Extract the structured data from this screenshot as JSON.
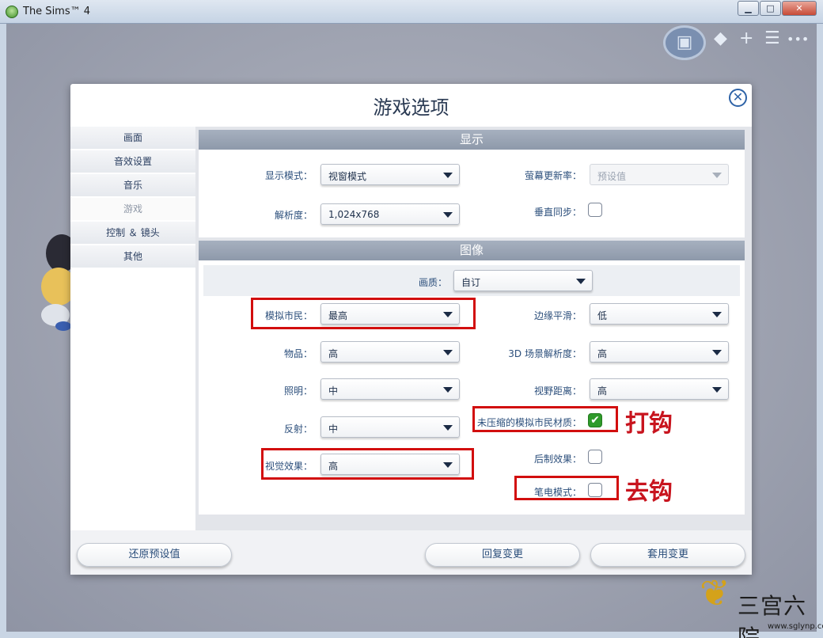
{
  "window": {
    "title": "The Sims™ 4",
    "controls": {
      "minimize": "▁",
      "maximize": "□",
      "close": "✕"
    }
  },
  "top_tools": {
    "photo": "▣",
    "tag": "◆",
    "plus": "+",
    "list": "☰",
    "more": "•••"
  },
  "dialog": {
    "title": "游戏选项",
    "close_icon": "✕",
    "nav": [
      "画面",
      "音效设置",
      "音乐",
      "游戏",
      "控制 ＆ 镜头",
      "其他"
    ],
    "display": {
      "header": "显示",
      "display_mode": {
        "label": "显示模式：",
        "value": "视窗模式"
      },
      "refresh_rate": {
        "label": "萤幕更新率：",
        "value": "预设值"
      },
      "resolution": {
        "label": "解析度：",
        "value": "1,024x768"
      },
      "vsync": {
        "label": "垂直同步：",
        "checked": false
      }
    },
    "graphics": {
      "header": "图像",
      "quality": {
        "label": "画质：",
        "value": "自订"
      },
      "sims": {
        "label": "模拟市民：",
        "value": "最高"
      },
      "edge_smoothing": {
        "label": "边缘平滑：",
        "value": "低"
      },
      "objects": {
        "label": "物品：",
        "value": "高"
      },
      "scene_resolution": {
        "label": "3D 场景解析度：",
        "value": "高"
      },
      "lighting": {
        "label": "照明：",
        "value": "中"
      },
      "view_distance": {
        "label": "视野距离：",
        "value": "高"
      },
      "reflections": {
        "label": "反射：",
        "value": "中"
      },
      "uncompressed_textures": {
        "label": "未压缩的模拟市民材质：",
        "checked": true,
        "check_glyph": "✔"
      },
      "visual_effects": {
        "label": "视觉效果：",
        "value": "高"
      },
      "post_processing": {
        "label": "后制效果：",
        "checked": false
      },
      "laptop_mode": {
        "label": "笔电模式：",
        "checked": false
      }
    },
    "buttons": {
      "restore_defaults": "还原预设值",
      "revert": "回复变更",
      "apply": "套用变更"
    }
  },
  "annotations": {
    "check_note": "打钩",
    "uncheck_note": "去钩"
  },
  "watermark": {
    "glyph": "❦",
    "text": "三宫六院",
    "url": "www.sglynp.com"
  },
  "colors": {
    "accent_red": "#d20e0e",
    "annotation_red": "#c8141e",
    "checkbox_green": "#2f9a2a",
    "label_blue": "#2b4e7b"
  }
}
